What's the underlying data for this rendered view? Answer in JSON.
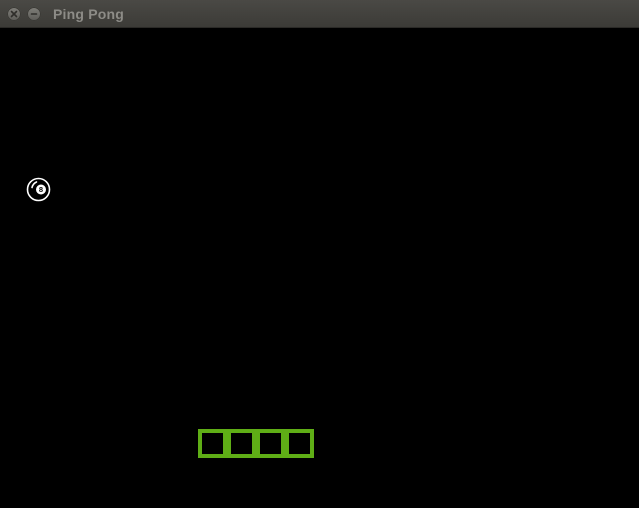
{
  "window": {
    "title": "Ping Pong"
  },
  "game": {
    "ball_label": "8",
    "paddle_blocks": 4
  },
  "colors": {
    "background": "#000000",
    "paddle": "#5fae16",
    "ball": "#ffffff",
    "titlebar": "#3c3b37",
    "title_text": "#8d8c87"
  },
  "icons": {
    "close": "close-icon",
    "minimize": "minimize-icon",
    "ball": "eight-ball-icon"
  }
}
